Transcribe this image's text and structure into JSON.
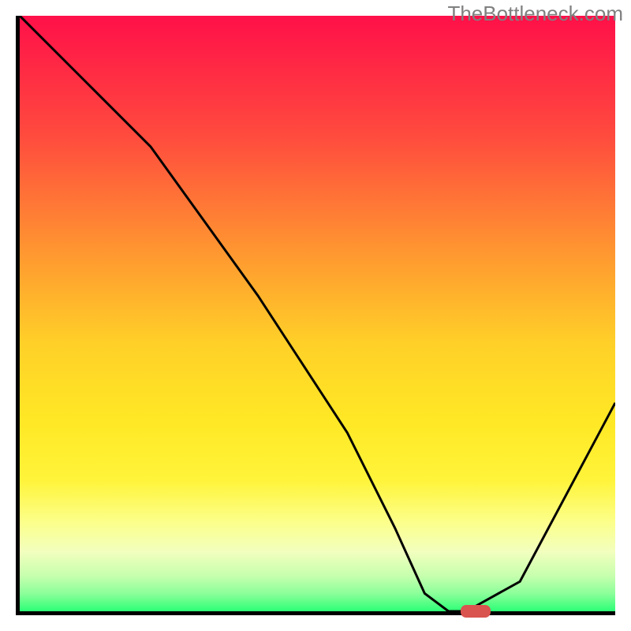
{
  "watermark": "TheBottleneck.com",
  "colors": {
    "axis": "#000000",
    "curve": "#000000",
    "marker": "#d9534f"
  },
  "chart_data": {
    "type": "line",
    "title": "",
    "xlabel": "",
    "ylabel": "",
    "xlim": [
      0,
      100
    ],
    "ylim": [
      0,
      100
    ],
    "x": [
      0,
      10,
      22,
      40,
      55,
      63,
      68,
      72,
      75,
      84,
      100
    ],
    "values": [
      100,
      90,
      78,
      53,
      30,
      14,
      3,
      0,
      0,
      5,
      35
    ],
    "flat_start_x": 72,
    "flat_end_x": 75,
    "marker": {
      "x_start": 73.5,
      "x_end": 78.5,
      "y": 0,
      "height": 2.0
    },
    "gradient_stops": [
      {
        "pct": 0,
        "color": "#ff1049"
      },
      {
        "pct": 20,
        "color": "#ff4a3e"
      },
      {
        "pct": 40,
        "color": "#ff9830"
      },
      {
        "pct": 55,
        "color": "#ffd028"
      },
      {
        "pct": 68,
        "color": "#ffe825"
      },
      {
        "pct": 78,
        "color": "#fff43a"
      },
      {
        "pct": 85,
        "color": "#fcff8a"
      },
      {
        "pct": 90,
        "color": "#f2ffbe"
      },
      {
        "pct": 94,
        "color": "#c7ffae"
      },
      {
        "pct": 97,
        "color": "#8cff9a"
      },
      {
        "pct": 100,
        "color": "#2cff76"
      }
    ]
  }
}
